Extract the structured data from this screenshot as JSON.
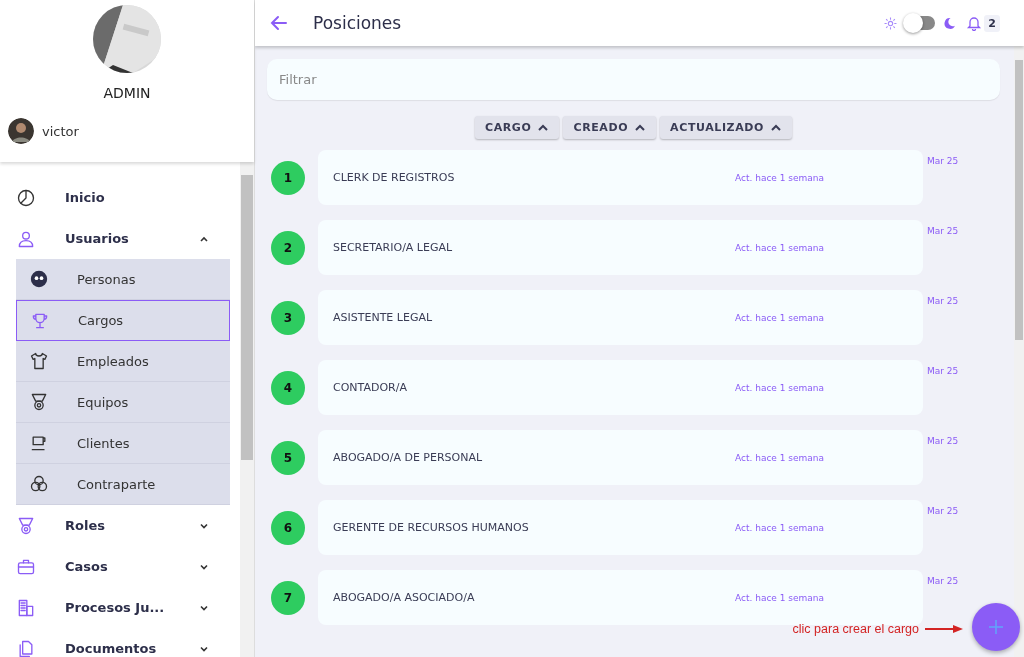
{
  "sidebar": {
    "role": "ADMIN",
    "user": "victor",
    "nav": [
      {
        "label": "Inicio"
      },
      {
        "label": "Usuarios",
        "expanded": true,
        "children": [
          {
            "label": "Personas",
            "selected": false
          },
          {
            "label": "Cargos",
            "selected": true
          },
          {
            "label": "Empleados",
            "selected": false
          },
          {
            "label": "Equipos",
            "selected": false
          },
          {
            "label": "Clientes",
            "selected": false
          },
          {
            "label": "Contraparte",
            "selected": false
          }
        ]
      },
      {
        "label": "Roles",
        "expanded": false
      },
      {
        "label": "Casos",
        "expanded": false
      },
      {
        "label": "Procesos Ju...",
        "expanded": false
      },
      {
        "label": "Documentos",
        "expanded": false
      }
    ]
  },
  "header": {
    "title": "Posiciones",
    "dark_mode": false,
    "notifications": "2"
  },
  "filter": {
    "placeholder": "Filtrar"
  },
  "sort_buttons": [
    "CARGO",
    "CREADO",
    "ACTUALIZADO"
  ],
  "rows": [
    {
      "index": "1",
      "name": "CLERK DE REGISTROS",
      "updated": "Act. hace 1 semana",
      "date": "Mar 25"
    },
    {
      "index": "2",
      "name": "SECRETARIO/A LEGAL",
      "updated": "Act. hace 1 semana",
      "date": "Mar 25"
    },
    {
      "index": "3",
      "name": "ASISTENTE LEGAL",
      "updated": "Act. hace 1 semana",
      "date": "Mar 25"
    },
    {
      "index": "4",
      "name": "CONTADOR/A",
      "updated": "Act. hace 1 semana",
      "date": "Mar 25"
    },
    {
      "index": "5",
      "name": "ABOGADO/A DE PERSONAL",
      "updated": "Act. hace 1 semana",
      "date": "Mar 25"
    },
    {
      "index": "6",
      "name": "GERENTE DE RECURSOS HUMANOS",
      "updated": "Act. hace 1 semana",
      "date": "Mar 25"
    },
    {
      "index": "7",
      "name": "ABOGADO/A ASOCIADO/A",
      "updated": "Act. hace 1 semana",
      "date": "Mar 25"
    }
  ],
  "annotation": "clic para crear el cargo"
}
